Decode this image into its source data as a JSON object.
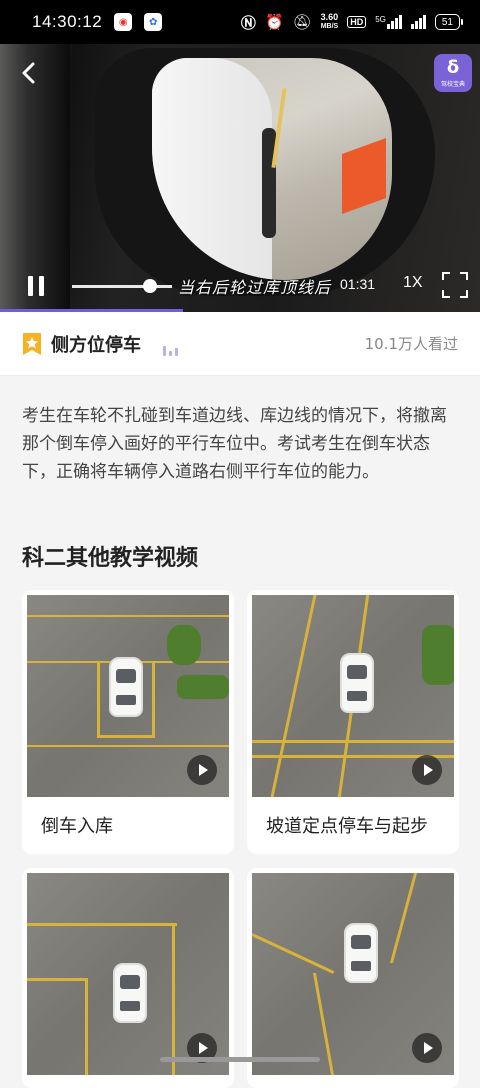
{
  "status_bar": {
    "time": "14:30:12",
    "network_speed": "3.60",
    "network_unit": "MB/S",
    "hd": "HD",
    "signal": "5G",
    "battery": "51"
  },
  "player": {
    "subtitle": "当右后轮过库顶线后",
    "duration": "01:31",
    "speed": "1X",
    "progress": 0.38,
    "logo_text": "驾校宝典"
  },
  "lesson": {
    "title": "侧方位停车",
    "views": "10.1万人看过",
    "description": "考生在车轮不扎碰到车道边线、库边线的情况下，将撤离那个倒车停入画好的平行车位中。考试考生在倒车状态下，正确将车辆停入道路右侧平行车位的能力。"
  },
  "section": {
    "title": "科二其他教学视频"
  },
  "videos": [
    {
      "label": "倒车入库"
    },
    {
      "label": "坡道定点停车与起步"
    },
    {
      "label": ""
    },
    {
      "label": ""
    }
  ],
  "colors": {
    "accent": "#6f5fe0",
    "badge": "#f5b323"
  }
}
